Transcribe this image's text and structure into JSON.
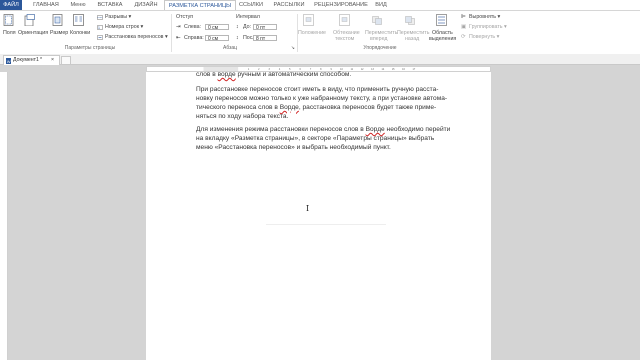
{
  "tabs": [
    "ФАЙЛ",
    "ГЛАВНАЯ",
    "Меню",
    "ВСТАВКА",
    "ДИЗАЙН",
    "РАЗМЕТКА СТРАНИЦЫ",
    "ССЫЛКИ",
    "РАССЫЛКИ",
    "РЕЦЕНЗИРОВАНИЕ",
    "ВИД"
  ],
  "active_tab": "РАЗМЕТКА СТРАНИЦЫ",
  "ribbon": {
    "page_setup": {
      "fields": "Поля",
      "orientation": "Ориентация",
      "size": "Размер",
      "columns": "Колонки",
      "breaks": "Разрывы",
      "line_numbers": "Номера строк",
      "hyphenation": "Расстановка переносов",
      "label": "Параметры страницы"
    },
    "paragraph": {
      "indent": "Отступ",
      "left": "Слева:",
      "left_val": "0 см",
      "right": "Справа:",
      "right_val": "0 см",
      "spacing": "Интервал",
      "before": "До:",
      "before_val": "0 пт",
      "after": "После:",
      "after_val": "8 пт",
      "label": "Абзац"
    },
    "arrange": {
      "position": "Положение",
      "wrap": [
        "Обтекание",
        "текстом"
      ],
      "forward": [
        "Переместить",
        "вперед"
      ],
      "backward": [
        "Переместить",
        "назад"
      ],
      "selection": [
        "Область",
        "выделения"
      ],
      "align": "Выровнять",
      "group": "Группировать",
      "rotate": "Повернуть",
      "label": "Упорядочение"
    }
  },
  "document_tab": "Документ1",
  "document": {
    "line0": [
      "слов в ",
      "ворде",
      " ручным и автоматическим способом."
    ],
    "para1": [
      "При расстановке переносов стоит иметь в виду, что применить ручную расста-",
      "новку переносов можно только к уже набранному тексту, а при установке автома-",
      [
        "тического переноса слов в ",
        "Ворде",
        ", расстановка переносов будет также приме-"
      ],
      "няться по ходу набора текста."
    ],
    "para2": [
      [
        "Для изменения режима расстановки переносов слов в ",
        "Ворде",
        " необходимо перейти"
      ],
      "на вкладку «Разметка страницы», в секторе «Параметры страницы» выбрать",
      "меню «Расстановка переносов» и выбрать необходимый пункт."
    ]
  },
  "ruler_marks": [
    "1",
    "2",
    "3",
    "4",
    "5",
    "6",
    "7",
    "8",
    "9",
    "10",
    "11",
    "12",
    "13",
    "14",
    "15",
    "16",
    "17"
  ],
  "colors": {
    "accent": "#2b579a",
    "spelling": "#d02020"
  }
}
